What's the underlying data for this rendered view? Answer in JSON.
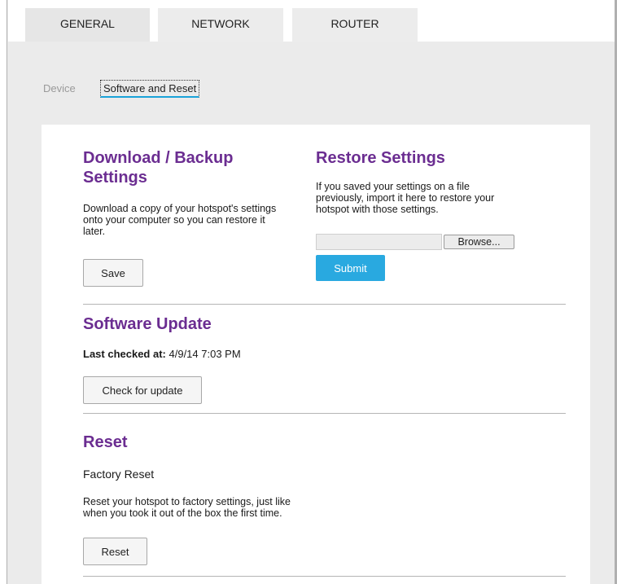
{
  "tabs": [
    {
      "label": "GENERAL",
      "active": true
    },
    {
      "label": "NETWORK",
      "active": false
    },
    {
      "label": "ROUTER",
      "active": false
    }
  ],
  "subnav": {
    "device": "Device",
    "software_and_reset": "Software and Reset"
  },
  "download": {
    "title_line1": "Download / Backup",
    "title_line2": "Settings",
    "description_lines": [
      "Download a copy of your hotspot's settings",
      "onto your computer so you can restore it",
      "later."
    ],
    "save_label": "Save"
  },
  "restore": {
    "title": "Restore Settings",
    "description_lines": [
      "If you saved your settings on a file",
      "previously, import it here to restore your",
      "hotspot with those settings."
    ],
    "file_value": "",
    "browse_label": "Browse...",
    "submit_label": "Submit"
  },
  "software_update": {
    "title": "Software Update",
    "last_checked_label": "Last checked at:",
    "last_checked_value": "4/9/14 7:03 PM",
    "check_label": "Check for update"
  },
  "reset": {
    "title": "Reset",
    "subtitle": "Factory Reset",
    "description_lines": [
      "Reset your hotspot to factory settings, just like",
      "when you took it out of the box the first time."
    ],
    "reset_label": "Reset"
  },
  "colors": {
    "accent_purple": "#6b2d91",
    "accent_blue": "#29a9e0",
    "background": "#ebebeb"
  }
}
